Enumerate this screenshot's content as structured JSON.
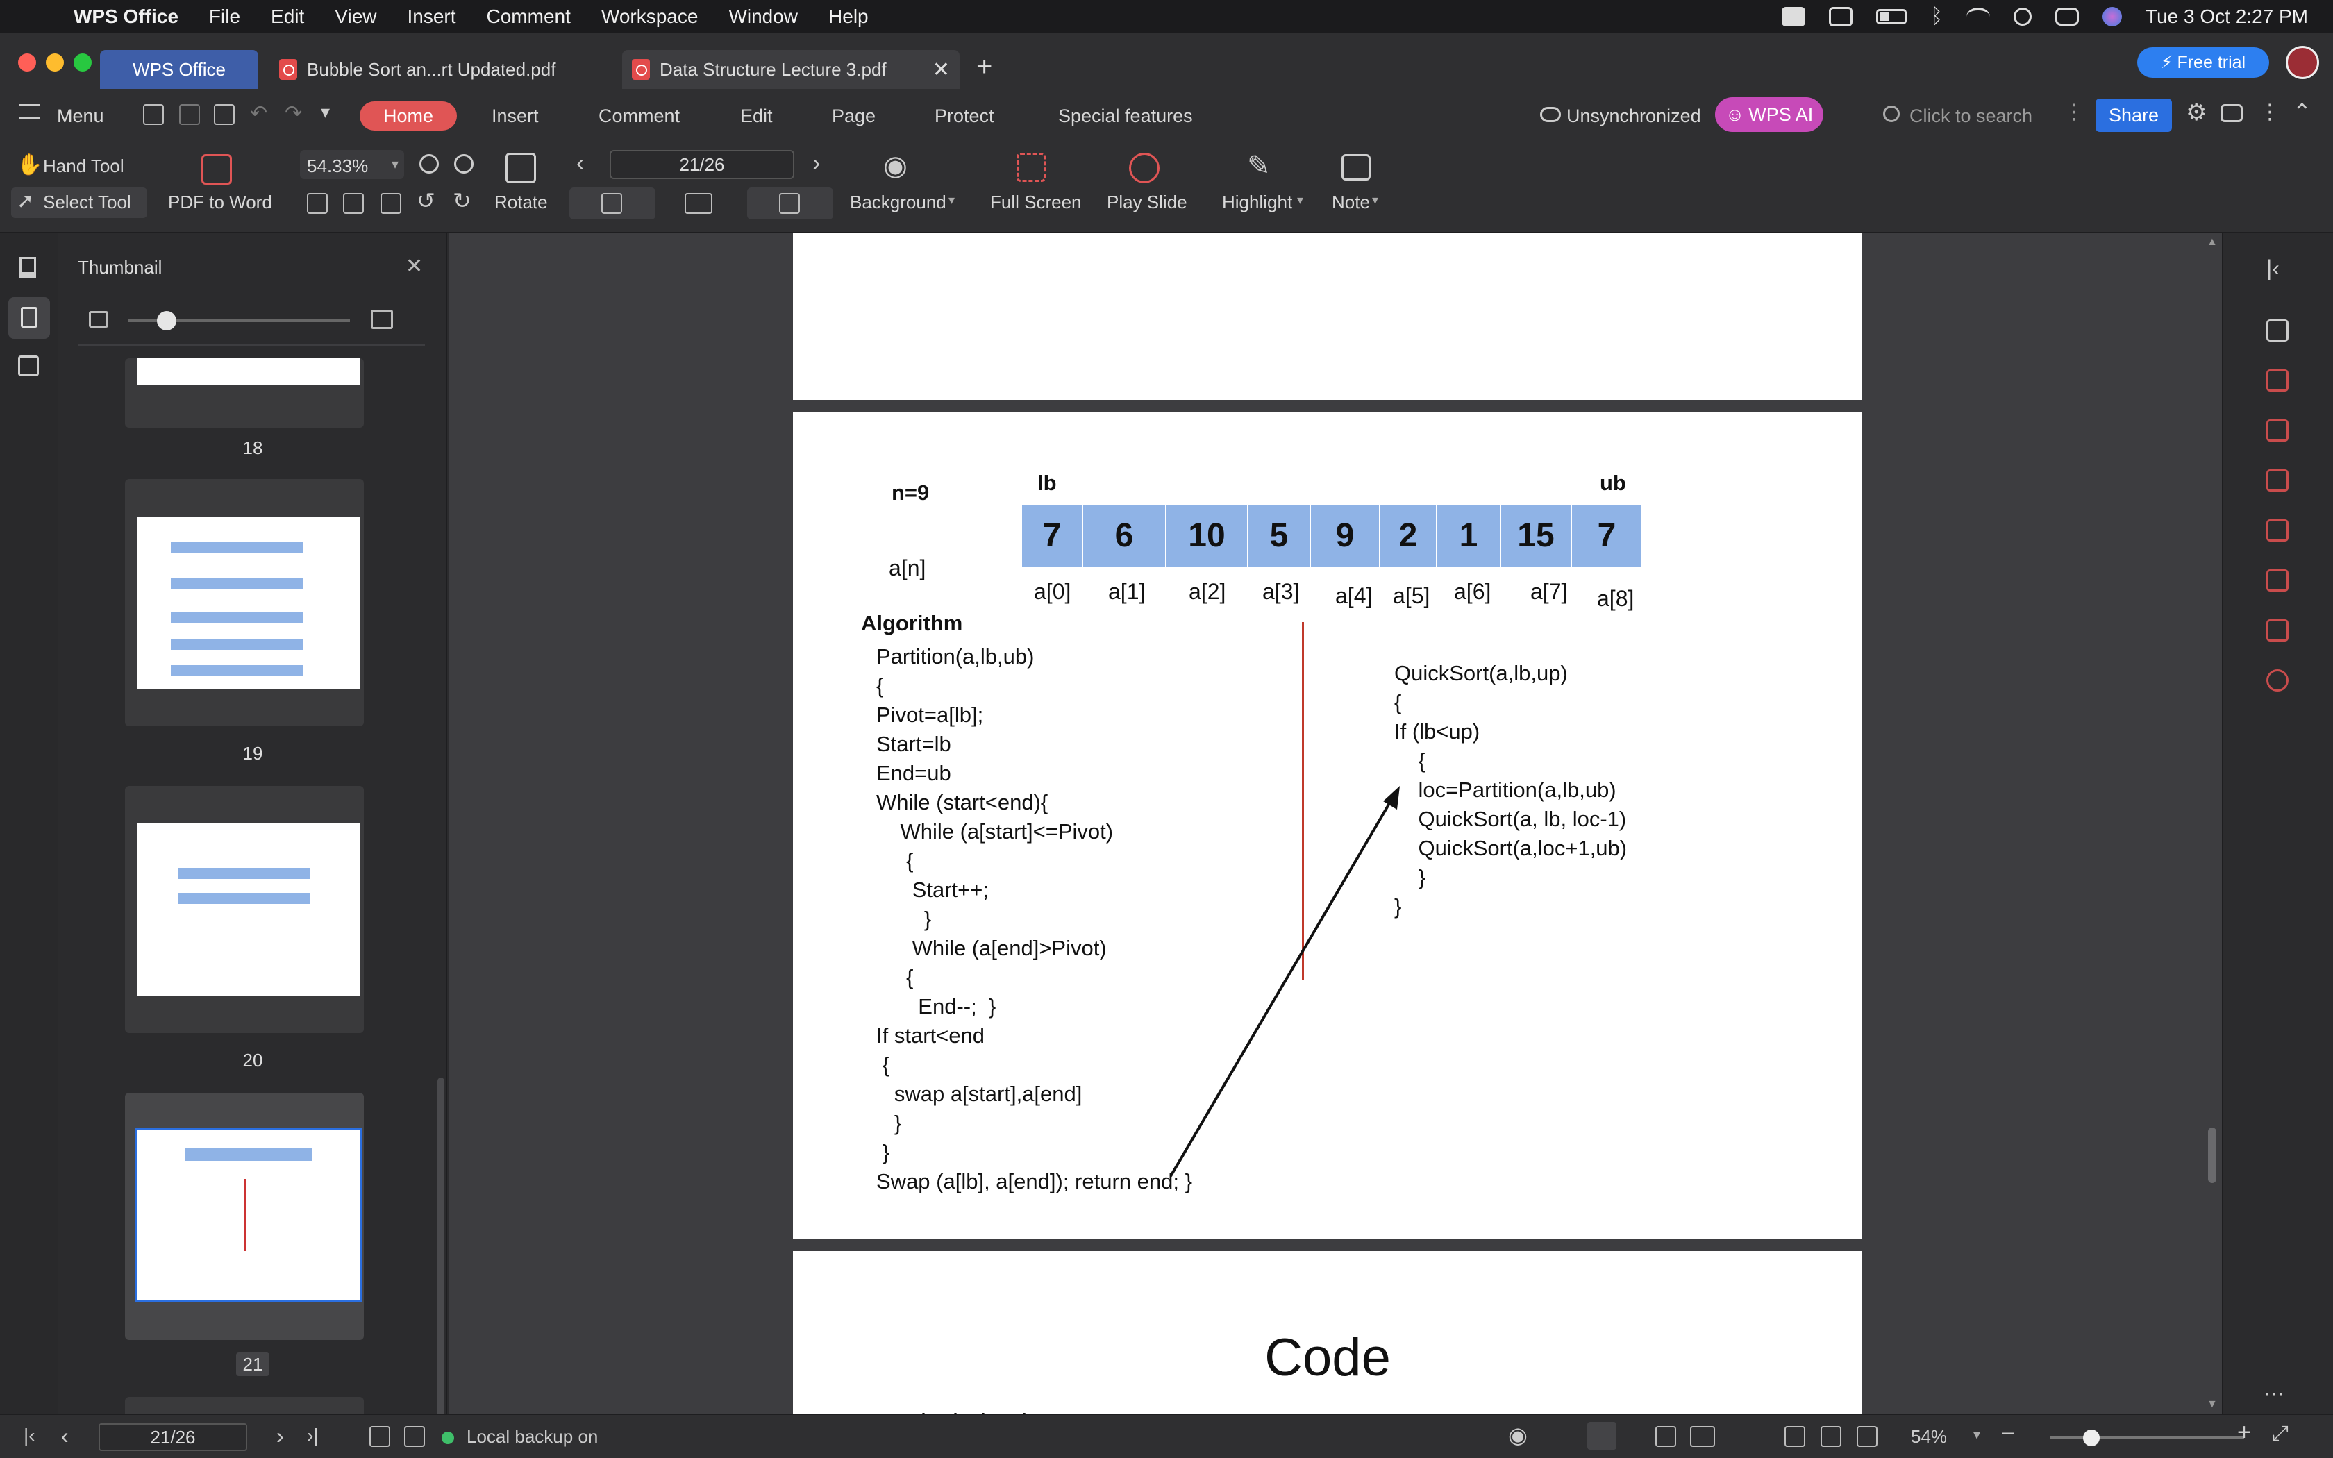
{
  "menubar": {
    "app_name": "WPS Office",
    "items": [
      "File",
      "Edit",
      "View",
      "Insert",
      "Comment",
      "Workspace",
      "Window",
      "Help"
    ],
    "datetime": "Tue 3 Oct  2:27 PM"
  },
  "tabs": {
    "home": "WPS Office",
    "doc1": "Bubble Sort an...rt Updated.pdf",
    "doc2": "Data Structure Lecture 3.pdf",
    "free_trial": "Free trial"
  },
  "ribbon": {
    "menu": "Menu",
    "tabs": [
      "Home",
      "Insert",
      "Comment",
      "Edit",
      "Page",
      "Protect",
      "Special features"
    ],
    "sync": "Unsynchronized",
    "wps_ai": "WPS AI",
    "search_placeholder": "Click to search",
    "share": "Share"
  },
  "toolbar": {
    "hand_tool": "Hand Tool",
    "select_tool": "Select Tool",
    "pdf_to_word": "PDF to Word",
    "zoom": "54.33%",
    "rotate": "Rotate",
    "page": "21/26",
    "background": "Background",
    "full_screen": "Full Screen",
    "play_slide": "Play Slide",
    "highlight": "Highlight",
    "note": "Note"
  },
  "thumbnails": {
    "title": "Thumbnail",
    "pages": [
      "18",
      "19",
      "20",
      "21"
    ]
  },
  "slide": {
    "n_label": "n=9",
    "lb": "lb",
    "ub": "ub",
    "an": "a[n]",
    "values": [
      "7",
      "6",
      "10",
      "5",
      "9",
      "2",
      "1",
      "15",
      "7"
    ],
    "indices": [
      "a[0]",
      "a[1]",
      "a[2]",
      "a[3]",
      "a[4]",
      "a[5]",
      "a[6]",
      "a[7]",
      "a[8]"
    ],
    "algorithm_title": "Algorithm",
    "left_code": [
      "Partition(a,lb,ub)",
      "{",
      "Pivot=a[lb];",
      "Start=lb",
      "End=ub",
      "While (start<end){",
      "    While (a[start]<=Pivot)",
      "     {",
      "      Start++;",
      "        }",
      "      While (a[end]>Pivot)",
      "     {",
      "       End--;  }",
      "If start<end",
      " {",
      "   swap a[start],a[end]",
      "   }",
      " }",
      "Swap (a[lb], a[end]); return end; }"
    ],
    "right_code": [
      "QuickSort(a,lb,up)",
      "{",
      "If (lb<up)",
      "    {",
      "    loc=Partition(a,lb,ub)",
      "    QuickSort(a, lb, loc-1)",
      "    QuickSort(a,loc+1,ub)",
      "    }",
      "}"
    ],
    "next_title": "Code",
    "next_line": "#include <iostream>"
  },
  "statusbar": {
    "page": "21/26",
    "backup": "Local backup on",
    "zoom": "54%"
  },
  "colors": {
    "accent_red": "#e05555",
    "share_blue": "#2b6fe0",
    "array_blue": "#8fb3e6",
    "wps_ai_pink": "#c74ab8"
  }
}
